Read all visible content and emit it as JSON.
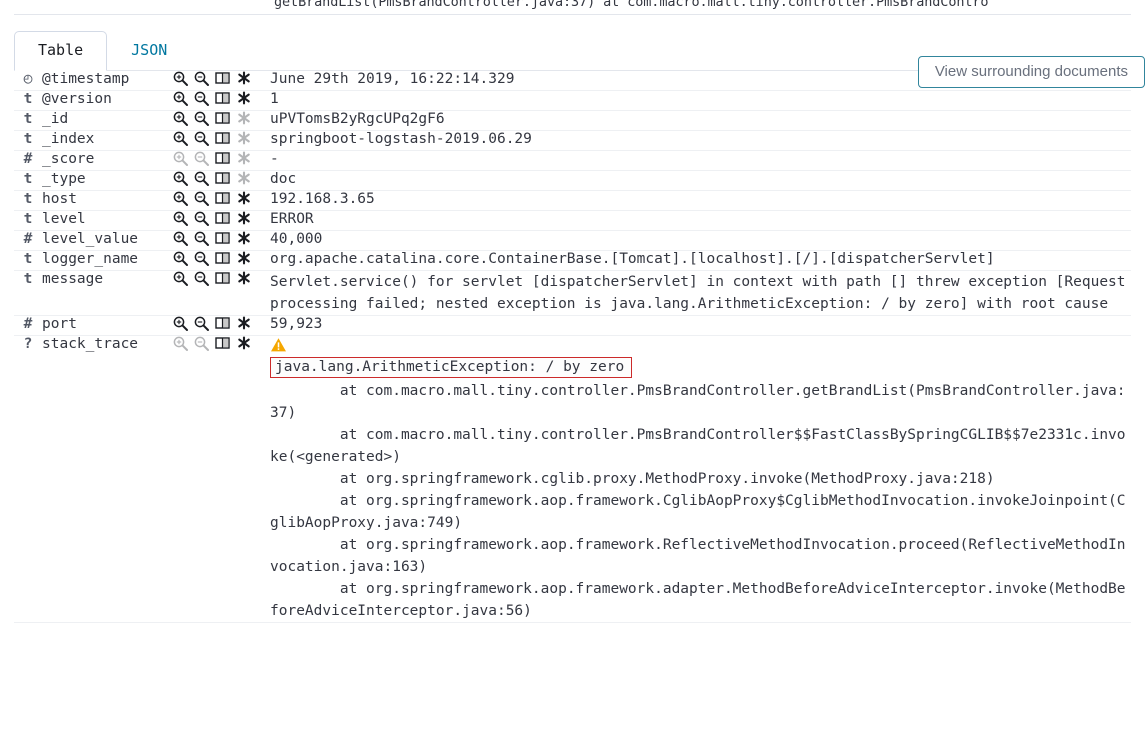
{
  "clipped_top_text": "getBrandList(PmsBrandController.java:37) at com.macro.mall.tiny.controller.PmsBrandContro",
  "tabs": [
    {
      "label": "Table",
      "active": true
    },
    {
      "label": "JSON",
      "active": false
    }
  ],
  "buttons": {
    "view_surrounding": "View surrounding documents"
  },
  "colors": {
    "accent": "#0077a0",
    "button_border": "#31859c",
    "warning": "#f5a700",
    "error_box_border": "#cc2b2b",
    "row_divider": "#eef0f3"
  },
  "icons": {
    "filter_for_value": "magnifier-plus-icon",
    "filter_out_value": "magnifier-minus-icon",
    "toggle_column": "table-column-icon",
    "filter_field_exists": "asterisk-icon",
    "warning": "warning-triangle-icon"
  },
  "field_type_glyphs": {
    "date": "◴",
    "string": "t",
    "number": "#",
    "unknown": "?"
  },
  "rows": [
    {
      "type": "date",
      "type_glyph": "◴",
      "name": "@timestamp",
      "actions_enabled": true,
      "exists_enabled": true,
      "value": "June 29th 2019, 16:22:14.329"
    },
    {
      "type": "string",
      "type_glyph": "t",
      "name": "@version",
      "actions_enabled": true,
      "exists_enabled": true,
      "value": "1"
    },
    {
      "type": "string",
      "type_glyph": "t",
      "name": "_id",
      "actions_enabled": true,
      "exists_enabled": false,
      "value": "uPVTomsB2yRgcUPq2gF6"
    },
    {
      "type": "string",
      "type_glyph": "t",
      "name": "_index",
      "actions_enabled": true,
      "exists_enabled": false,
      "value": "springboot-logstash-2019.06.29"
    },
    {
      "type": "number",
      "type_glyph": "#",
      "name": "_score",
      "actions_enabled": false,
      "exists_enabled": false,
      "value": " -"
    },
    {
      "type": "string",
      "type_glyph": "t",
      "name": "_type",
      "actions_enabled": true,
      "exists_enabled": false,
      "value": "doc"
    },
    {
      "type": "string",
      "type_glyph": "t",
      "name": "host",
      "actions_enabled": true,
      "exists_enabled": true,
      "value": "192.168.3.65"
    },
    {
      "type": "string",
      "type_glyph": "t",
      "name": "level",
      "actions_enabled": true,
      "exists_enabled": true,
      "value": "ERROR"
    },
    {
      "type": "number",
      "type_glyph": "#",
      "name": "level_value",
      "actions_enabled": true,
      "exists_enabled": true,
      "value": "40,000"
    },
    {
      "type": "string",
      "type_glyph": "t",
      "name": "logger_name",
      "actions_enabled": true,
      "exists_enabled": true,
      "value": "org.apache.catalina.core.ContainerBase.[Tomcat].[localhost].[/].[dispatcherServlet]"
    },
    {
      "type": "string",
      "type_glyph": "t",
      "name": "message",
      "actions_enabled": true,
      "exists_enabled": true,
      "value": "Servlet.service() for servlet [dispatcherServlet] in context with path [] threw exception [Request processing failed; nested exception is java.lang.ArithmeticException: / by zero] with root cause"
    },
    {
      "type": "number",
      "type_glyph": "#",
      "name": "port",
      "actions_enabled": true,
      "exists_enabled": true,
      "value": "59,923"
    },
    {
      "type": "unknown",
      "type_glyph": "?",
      "name": "stack_trace",
      "actions_enabled": false,
      "exists_enabled": true,
      "value": ""
    }
  ],
  "stack_trace": {
    "exception_header": "java.lang.ArithmeticException: / by zero",
    "lines": [
      "        at com.macro.mall.tiny.controller.PmsBrandController.getBrandList(PmsBrandController.java:37)",
      "        at com.macro.mall.tiny.controller.PmsBrandController$$FastClassBySpringCGLIB$$7e2331c.invoke(<generated>)",
      "        at org.springframework.cglib.proxy.MethodProxy.invoke(MethodProxy.java:218)",
      "        at org.springframework.aop.framework.CglibAopProxy$CglibMethodInvocation.invokeJoinpoint(CglibAopProxy.java:749)",
      "        at org.springframework.aop.framework.ReflectiveMethodInvocation.proceed(ReflectiveMethodInvocation.java:163)",
      "        at org.springframework.aop.framework.adapter.MethodBeforeAdviceInterceptor.invoke(MethodBeforeAdviceInterceptor.java:56)"
    ]
  }
}
